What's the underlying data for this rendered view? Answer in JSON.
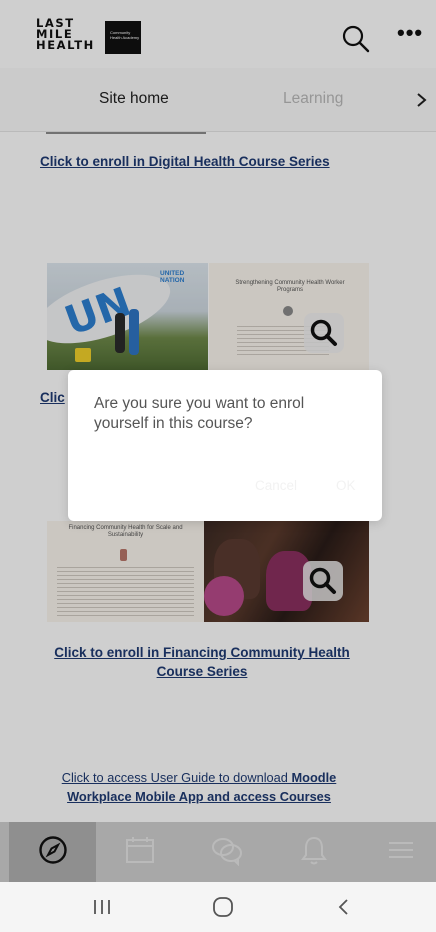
{
  "header": {
    "logo_line1": "LAST",
    "logo_line2": "MILE",
    "logo_line3": "HEALTH",
    "logo_badge": "Community Health Academy",
    "search_icon": "search-icon",
    "more_icon": "more-horizontal-icon",
    "more_glyph": "•••"
  },
  "tabs": {
    "items": [
      {
        "label": "Site home"
      },
      {
        "label": "Learning"
      }
    ],
    "next_icon": "chevron-right-icon"
  },
  "content": {
    "digital_link": "Click to enroll in Digital Health Course Series",
    "partial_link": "Clic",
    "plane_tag": "UNITED NATION",
    "plane_letters": "UN",
    "doc1_title": "Strengthening Community Health Worker Programs",
    "doc2_title": "Financing Community Health for Scale and Sustainability",
    "financing_link": "Click to enroll in Financing Community Health Course Series",
    "guide_prefix": "Click to access User Guide to download ",
    "guide_bold": "Moodle Workplace Mobile App and access Courses"
  },
  "dialog": {
    "message": "Are you sure you want to enrol yourself in this course?",
    "cancel_label": "Cancel",
    "ok_label": "OK"
  },
  "bottom_nav": {
    "items": [
      {
        "icon": "compass-icon",
        "active": true
      },
      {
        "icon": "calendar-icon",
        "active": false
      },
      {
        "icon": "chat-bubbles-icon",
        "active": false
      },
      {
        "icon": "bell-icon",
        "active": false
      },
      {
        "icon": "menu-icon",
        "active": false
      }
    ]
  },
  "system_nav": {
    "items": [
      {
        "icon": "recent-apps-icon"
      },
      {
        "icon": "home-icon"
      },
      {
        "icon": "back-icon"
      }
    ]
  },
  "colors": {
    "link": "#1f3b73",
    "dim_overlay": "rgba(0,0,0,0.19)",
    "bottom_nav_bg": "#cfcfcf",
    "bottom_nav_active": "#b0b0b0"
  }
}
